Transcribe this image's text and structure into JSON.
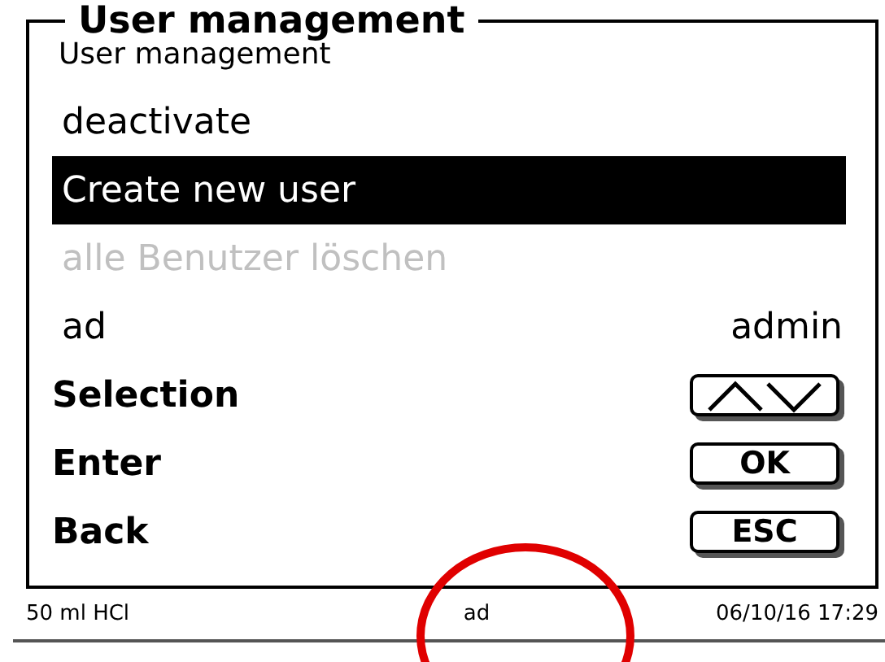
{
  "screen": {
    "title": "User management",
    "subtitle": "User management"
  },
  "menu": [
    {
      "label": "deactivate",
      "selected": false,
      "disabled": false
    },
    {
      "label": "Create new user",
      "selected": true,
      "disabled": false
    },
    {
      "label": "alle Benutzer löschen",
      "selected": false,
      "disabled": true
    }
  ],
  "field": {
    "label": "ad",
    "value": "admin"
  },
  "softkeys": [
    {
      "label": "Selection",
      "kind": "arrows"
    },
    {
      "label": "Enter",
      "kind": "text",
      "key": "OK"
    },
    {
      "label": "Back",
      "kind": "text",
      "key": "ESC"
    }
  ],
  "status_bar": {
    "left": "50 ml HCl",
    "center": "ad",
    "right": "06/10/16 17:29"
  }
}
